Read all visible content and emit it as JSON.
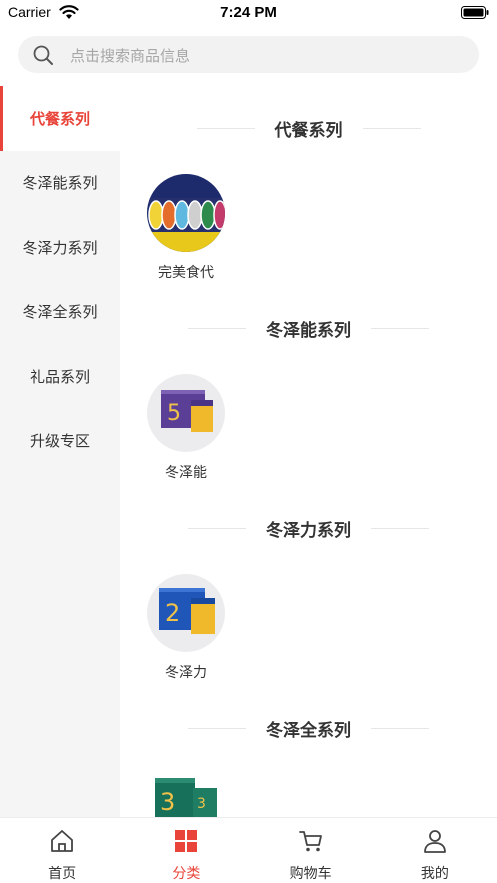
{
  "status_bar": {
    "carrier": "Carrier",
    "time": "7:24 PM"
  },
  "search": {
    "placeholder": "点击搜索商品信息"
  },
  "sidebar": {
    "items": [
      {
        "label": "代餐系列",
        "active": true
      },
      {
        "label": "冬泽能系列",
        "active": false
      },
      {
        "label": "冬泽力系列",
        "active": false
      },
      {
        "label": "冬泽全系列",
        "active": false
      },
      {
        "label": "礼品系列",
        "active": false
      },
      {
        "label": "升级专区",
        "active": false
      }
    ]
  },
  "sections": [
    {
      "title": "代餐系列",
      "product": {
        "name": "完美食代",
        "icon": "meal-replacement-package"
      }
    },
    {
      "title": "冬泽能系列",
      "product": {
        "name": "冬泽能",
        "icon": "product-box-5"
      }
    },
    {
      "title": "冬泽力系列",
      "product": {
        "name": "冬泽力",
        "icon": "product-box-2"
      }
    },
    {
      "title": "冬泽全系列",
      "product": {
        "name": "",
        "icon": "product-box-3"
      }
    }
  ],
  "tab_bar": {
    "items": [
      {
        "label": "首页",
        "icon": "home-icon",
        "active": false
      },
      {
        "label": "分类",
        "icon": "category-grid-icon",
        "active": true
      },
      {
        "label": "购物车",
        "icon": "cart-icon",
        "active": false
      },
      {
        "label": "我的",
        "icon": "user-icon",
        "active": false
      }
    ]
  },
  "colors": {
    "accent": "#e8443a",
    "sidebar_bg": "#f5f5f5",
    "search_bg": "#f2f2f2"
  }
}
